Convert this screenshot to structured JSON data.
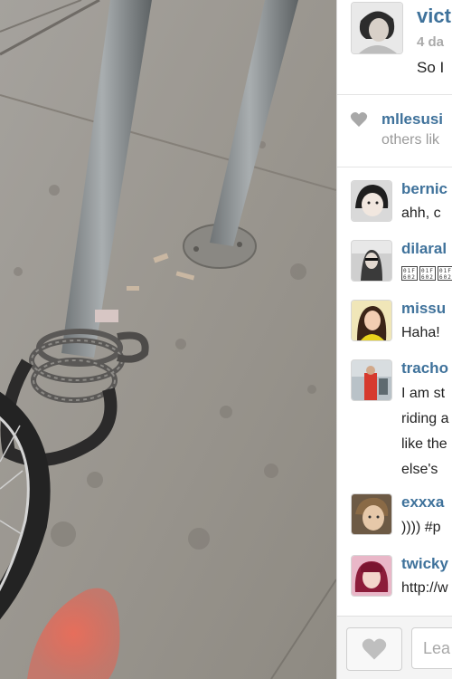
{
  "post": {
    "owner_username": "vict",
    "time_ago": "4 da",
    "caption": "So I"
  },
  "likes": {
    "first_liker": "mllesusi",
    "others_text": "others lik"
  },
  "comments": [
    {
      "username": "bernic",
      "lines": [
        "ahh, c"
      ]
    },
    {
      "username": "dilaral",
      "lines": [
        "\u0001F602\u0001F602\u0001F602"
      ],
      "glyph_style": "unrendered-emoji"
    },
    {
      "username": "missu",
      "lines": [
        "Haha!"
      ]
    },
    {
      "username": "tracho",
      "lines": [
        "I am st",
        "riding a",
        "like the",
        "else's"
      ]
    },
    {
      "username": "exxxa",
      "lines": [
        "))))  #p"
      ]
    },
    {
      "username": "twicky",
      "lines": [
        "http://w"
      ]
    }
  ],
  "footer": {
    "comment_placeholder": "Lea"
  },
  "colors": {
    "username": "#3f729b",
    "text": "#222222",
    "muted": "#9a9a9a",
    "street_paint": "#e8604f"
  },
  "icons": {
    "like": "heart-icon",
    "likes_summary": "heart-icon"
  }
}
